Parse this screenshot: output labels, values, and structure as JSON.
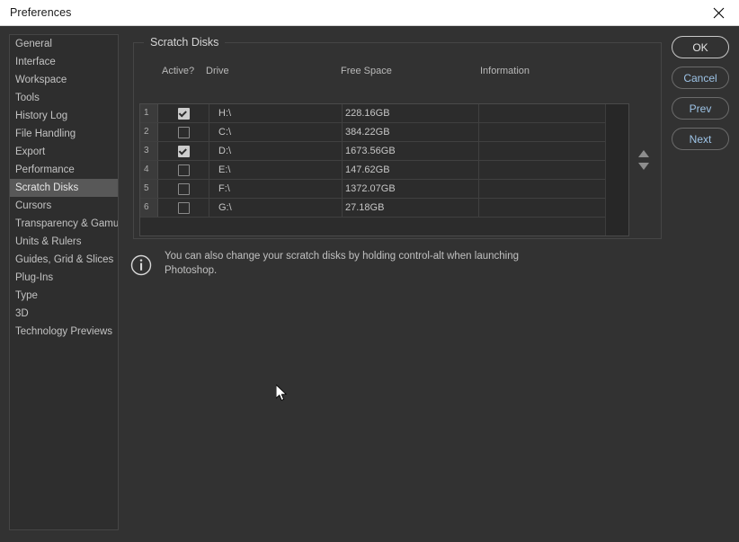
{
  "window": {
    "title": "Preferences",
    "close_icon": "close-icon"
  },
  "sidebar": {
    "items": [
      {
        "label": "General",
        "selected": false
      },
      {
        "label": "Interface",
        "selected": false
      },
      {
        "label": "Workspace",
        "selected": false
      },
      {
        "label": "Tools",
        "selected": false
      },
      {
        "label": "History Log",
        "selected": false
      },
      {
        "label": "File Handling",
        "selected": false
      },
      {
        "label": "Export",
        "selected": false
      },
      {
        "label": "Performance",
        "selected": false
      },
      {
        "label": "Scratch Disks",
        "selected": true
      },
      {
        "label": "Cursors",
        "selected": false
      },
      {
        "label": "Transparency & Gamut",
        "selected": false
      },
      {
        "label": "Units & Rulers",
        "selected": false
      },
      {
        "label": "Guides, Grid & Slices",
        "selected": false
      },
      {
        "label": "Plug-Ins",
        "selected": false
      },
      {
        "label": "Type",
        "selected": false
      },
      {
        "label": "3D",
        "selected": false
      },
      {
        "label": "Technology Previews",
        "selected": false
      }
    ]
  },
  "main": {
    "group_title": "Scratch Disks",
    "columns": {
      "active": "Active?",
      "drive": "Drive",
      "free_space": "Free Space",
      "information": "Information"
    },
    "rows": [
      {
        "num": "1",
        "active": true,
        "drive": "H:\\",
        "free_space": "228.16GB",
        "information": ""
      },
      {
        "num": "2",
        "active": false,
        "drive": "C:\\",
        "free_space": "384.22GB",
        "information": ""
      },
      {
        "num": "3",
        "active": true,
        "drive": "D:\\",
        "free_space": "1673.56GB",
        "information": ""
      },
      {
        "num": "4",
        "active": false,
        "drive": "E:\\",
        "free_space": "147.62GB",
        "information": ""
      },
      {
        "num": "5",
        "active": false,
        "drive": "F:\\",
        "free_space": "1372.07GB",
        "information": ""
      },
      {
        "num": "6",
        "active": false,
        "drive": "G:\\",
        "free_space": "27.18GB",
        "information": ""
      }
    ],
    "order_up_icon": "arrow-up-icon",
    "order_down_icon": "arrow-down-icon",
    "note": {
      "icon": "info-icon",
      "text": "You can also change your scratch disks by holding control-alt when launching Photoshop."
    }
  },
  "buttons": {
    "ok": "OK",
    "cancel": "Cancel",
    "prev": "Prev",
    "next": "Next"
  },
  "colors": {
    "dialog_bg": "#323232",
    "titlebar_bg": "#ffffff",
    "selection": "#585858",
    "button_text": "#9dc3e6",
    "text": "#c6c6c6"
  }
}
